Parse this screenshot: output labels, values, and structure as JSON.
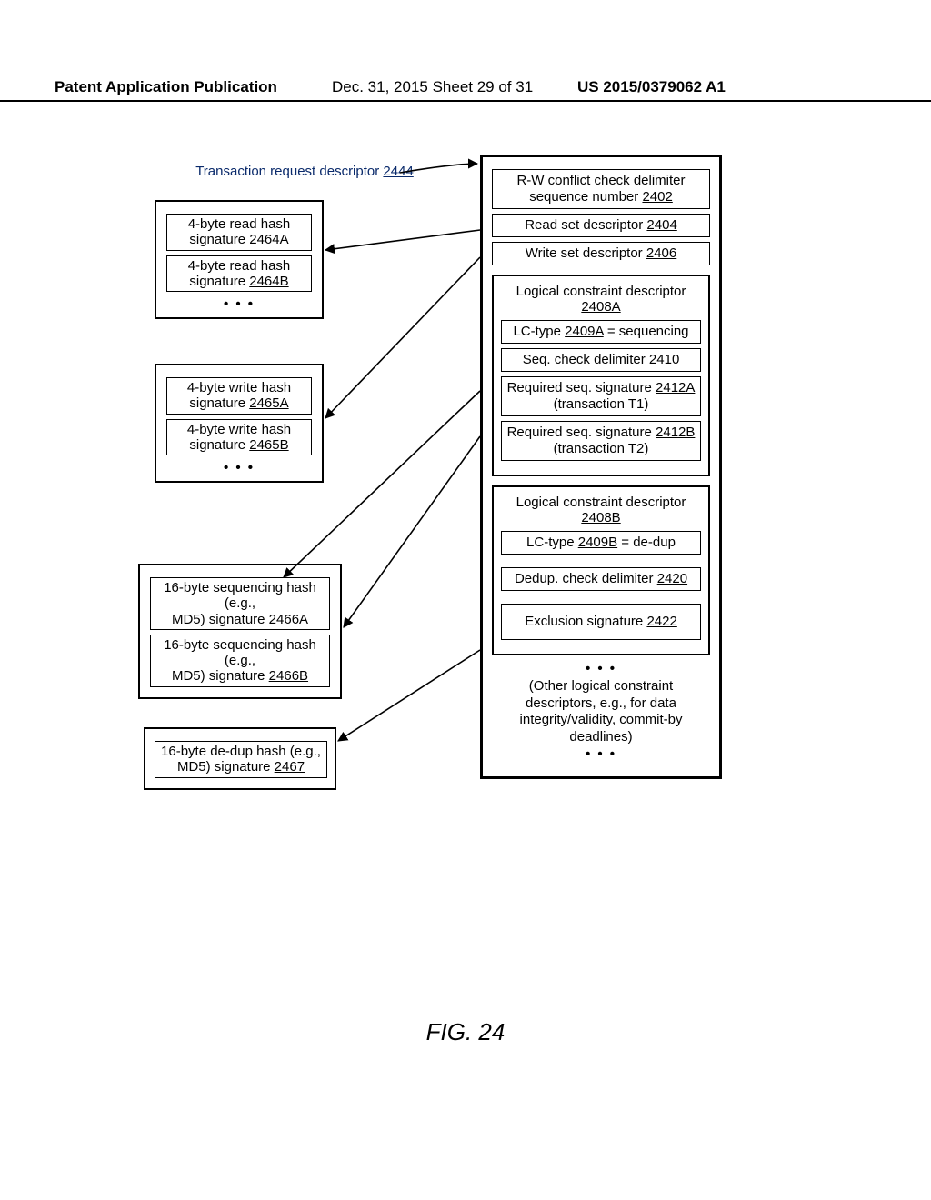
{
  "header": {
    "left": "Patent Application Publication",
    "mid": "Dec. 31, 2015   Sheet 29 of 31",
    "right": "US 2015/0379062 A1"
  },
  "figure_label": "FIG. 24",
  "title": {
    "text": "Transaction request descriptor ",
    "ref": "2444"
  },
  "right": {
    "rw": {
      "t1": "R-W conflict check delimiter",
      "t2": "sequence number ",
      "ref": "2402"
    },
    "read": {
      "t": "Read set descriptor ",
      "ref": "2404"
    },
    "write": {
      "t": "Write set descriptor ",
      "ref": "2406"
    },
    "lcA": {
      "title": "Logical constraint descriptor ",
      "ref": "2408A",
      "lctype_pre": "LC-type ",
      "lctype_ref": "2409A",
      "lctype_post": " = sequencing",
      "seqdelim": {
        "t": "Seq. check delimiter ",
        "ref": "2410"
      },
      "reqA": {
        "t1": "Required seq. signature ",
        "ref": "2412A",
        "t2": "(transaction T1)"
      },
      "reqB": {
        "t1": "Required seq. signature ",
        "ref": "2412B",
        "t2": "(transaction T2)"
      }
    },
    "lcB": {
      "title": "Logical constraint descriptor ",
      "ref": "2408B",
      "lctype_pre": "LC-type ",
      "lctype_ref": "2409B",
      "lctype_post": " = de-dup",
      "dedup": {
        "t": "Dedup. check delimiter ",
        "ref": "2420"
      },
      "excl": {
        "t": "Exclusion signature ",
        "ref": "2422"
      }
    },
    "other": {
      "dots": "• • •",
      "line1": "(Other logical constraint",
      "line2": "descriptors, e.g., for data",
      "line3": "integrity/validity, commit-by",
      "line4": "deadlines)"
    }
  },
  "left": {
    "readbox": {
      "a_t": "4-byte read hash",
      "a_s": "signature ",
      "a_ref": "2464A",
      "b_t": "4-byte read hash",
      "b_s": "signature ",
      "b_ref": "2464B",
      "dots": "• • •"
    },
    "writebox": {
      "a_t": "4-byte write hash",
      "a_s": "signature ",
      "a_ref": "2465A",
      "b_t": "4-byte write hash",
      "b_s": "signature ",
      "b_ref": "2465B",
      "dots": "• • •"
    },
    "seqbox": {
      "a_t": "16-byte sequencing hash (e.g.,",
      "a_s": "MD5) signature ",
      "a_ref": "2466A",
      "b_t": "16-byte sequencing hash (e.g.,",
      "b_s": "MD5) signature ",
      "b_ref": "2466B"
    },
    "dedupbox": {
      "t": "16-byte de-dup hash (e.g.,",
      "s": "MD5) signature ",
      "ref": "2467"
    }
  }
}
